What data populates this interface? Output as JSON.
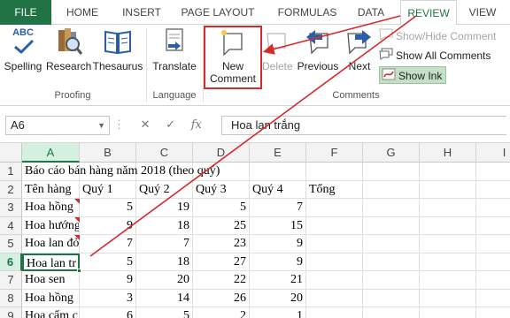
{
  "tabs": [
    "FILE",
    "HOME",
    "INSERT",
    "PAGE LAYOUT",
    "FORMULAS",
    "DATA",
    "REVIEW",
    "VIEW"
  ],
  "ribbon": {
    "proofing": {
      "spelling_icon_text": "ABC",
      "spelling": "Spelling",
      "research": "Research",
      "thesaurus": "Thesaurus",
      "group": "Proofing"
    },
    "language": {
      "translate": "Translate",
      "group": "Language"
    },
    "comments": {
      "new_comment_line1": "New",
      "new_comment_line2": "Comment",
      "delete": "Delete",
      "previous": "Previous",
      "next": "Next",
      "show_hide": "Show/Hide Comment",
      "show_all": "Show All Comments",
      "show_ink": "Show Ink",
      "group": "Comments"
    }
  },
  "formula_bar": {
    "name_box": "A6",
    "fx_label": "fx",
    "content": "Hoa lan trắng"
  },
  "sheet": {
    "columns": [
      "A",
      "B",
      "C",
      "D",
      "E",
      "F",
      "G",
      "H",
      "I"
    ],
    "row_numbers": [
      "1",
      "2",
      "3",
      "4",
      "5",
      "6",
      "7",
      "8",
      "9"
    ],
    "title": "Báo cáo bán hàng năm 2018 (theo quý)",
    "headers": [
      "Tên hàng",
      "Quý 1",
      "Quý 2",
      "Quý 3",
      "Quý 4",
      "Tổng"
    ],
    "rows": [
      {
        "name": "Hoa hồng",
        "values": [
          "5",
          "19",
          "5",
          "7"
        ]
      },
      {
        "name": "Hoa hướng",
        "values": [
          "9",
          "18",
          "25",
          "15"
        ]
      },
      {
        "name": "Hoa lan đỏ",
        "values": [
          "7",
          "7",
          "23",
          "9"
        ]
      },
      {
        "name": "Hoa lan tr",
        "values": [
          "5",
          "18",
          "27",
          "9"
        ]
      },
      {
        "name": "Hoa sen",
        "values": [
          "9",
          "20",
          "22",
          "21"
        ]
      },
      {
        "name": "Hoa hồng",
        "values": [
          "3",
          "14",
          "26",
          "20"
        ]
      },
      {
        "name": "Hoa cẩm c",
        "values": [
          "6",
          "5",
          "2",
          "1"
        ]
      }
    ]
  },
  "colors": {
    "excel_green": "#217346",
    "annotation_red": "#d62a2a"
  }
}
